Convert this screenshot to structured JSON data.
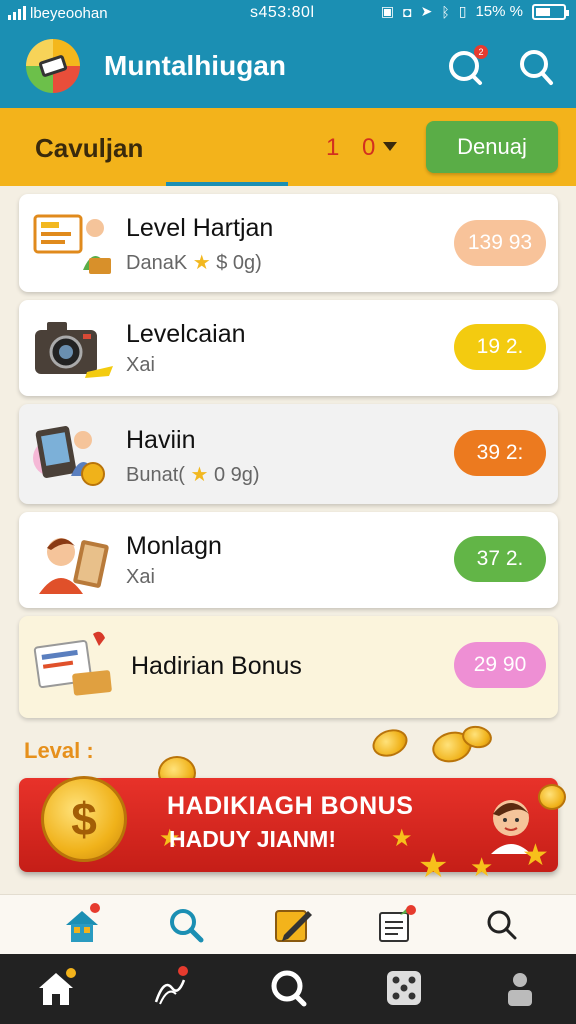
{
  "status_bar": {
    "carrier": "lbeyeoohan",
    "time": "s453:80l",
    "battery": "15% %"
  },
  "header": {
    "title": "Muntalhiugan"
  },
  "filter": {
    "label": "Cavuljan",
    "value": "1 0",
    "button_label": "Denuaj"
  },
  "items": [
    {
      "title": "Level Hartjan",
      "sub_pre": "DanaK",
      "sub_post": "$ 0g)",
      "value": "139 93",
      "pill_color": "#f8c39a"
    },
    {
      "title": "Levelcaian",
      "sub_pre": "Xai",
      "sub_post": "",
      "value": "19 2.",
      "pill_color": "#f3cb10"
    },
    {
      "title": "Haviin",
      "sub_pre": "Bunat(",
      "sub_post": "0 9g)",
      "value": "39 2:",
      "pill_color": "#ec7a1f"
    },
    {
      "title": "Monlagn",
      "sub_pre": "Xai",
      "sub_post": "",
      "value": "37 2.",
      "pill_color": "#62b547"
    },
    {
      "title": "Hadirian Bonus",
      "sub_pre": "",
      "sub_post": "",
      "value": "29 90",
      "pill_color": "#ee8fd4"
    }
  ],
  "promo": {
    "section_label": "Leval :",
    "title": "HADIKIAGH BONUS",
    "subtitle": "HADUY JIANM!",
    "coin_symbol": "$"
  },
  "icons": {
    "nav": [
      "home-icon",
      "search-icon",
      "edit-icon",
      "document-icon",
      "search-icon"
    ],
    "system": [
      "home-icon",
      "activity-icon",
      "search-icon",
      "dice-icon",
      "profile-icon"
    ]
  },
  "colors": {
    "header": "#1b8fb3",
    "filter_bar": "#f3b31b",
    "button": "#5aad47",
    "promo": "#e8322a"
  }
}
